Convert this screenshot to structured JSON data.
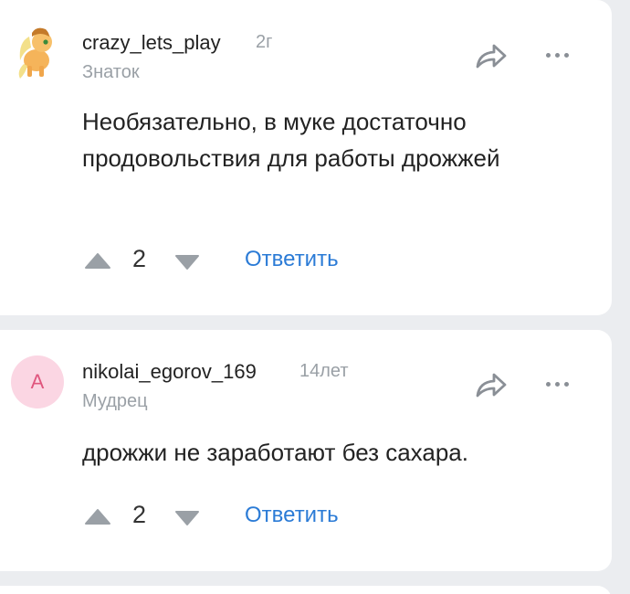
{
  "comments": [
    {
      "author": "crazy_lets_play",
      "age": "2г",
      "rank": "Знаток",
      "text": "Необязательно, в муке достаточно продовольствия для работы дрожжей",
      "votes": "2",
      "reply_label": "Ответить",
      "avatar": "pony-avatar-icon"
    },
    {
      "author": "nikolai_egorov_169",
      "age": "14лет",
      "rank": "Мудрец",
      "text": "дрожжи не заработают без сахара.",
      "votes": "2",
      "reply_label": "Ответить",
      "avatar_letter": "A",
      "avatar_color": "#fbd6e3"
    }
  ],
  "colors": {
    "accent": "#2b7bd6",
    "background": "#ebedf0",
    "muted": "#9aa0a6"
  }
}
